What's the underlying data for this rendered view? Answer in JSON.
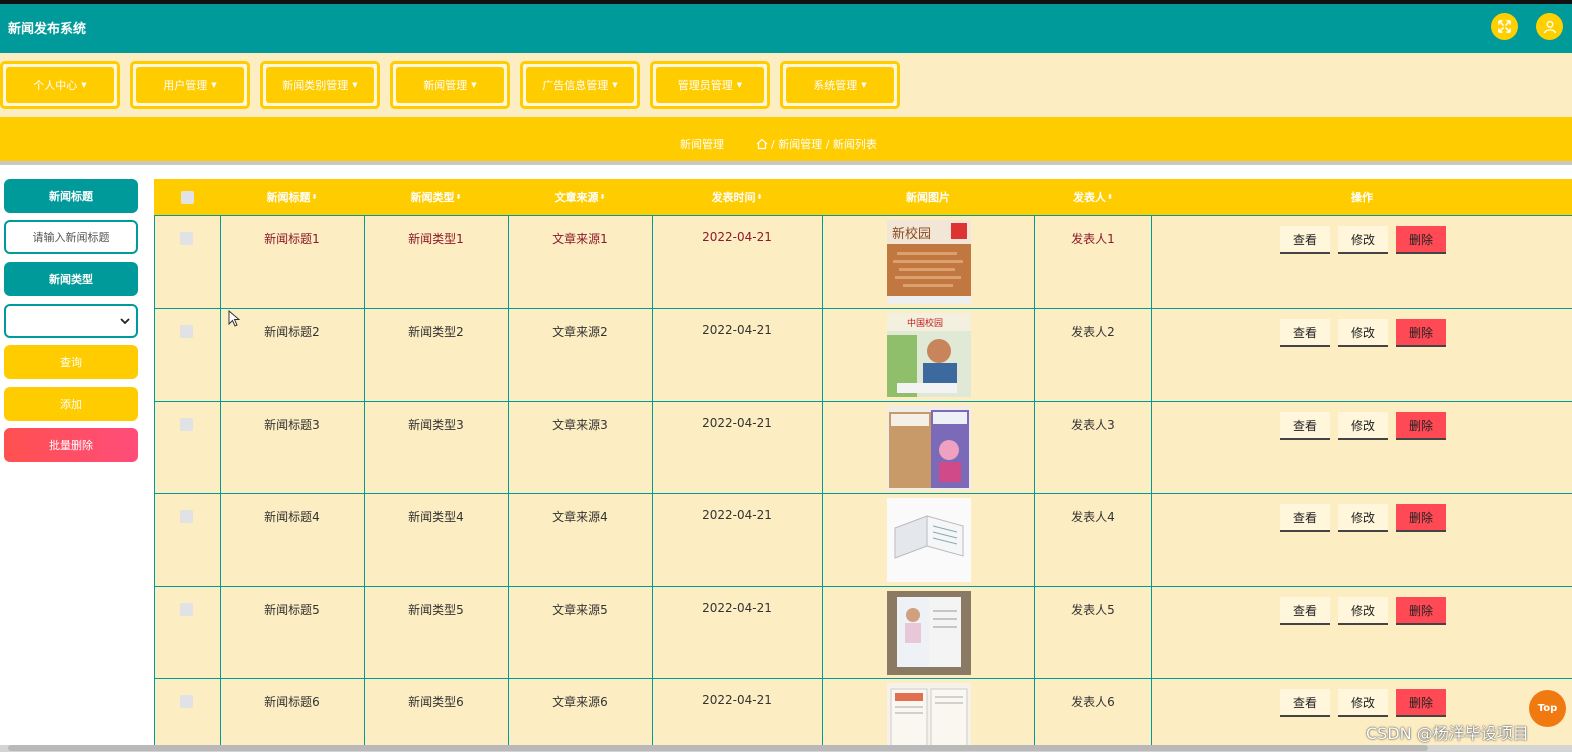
{
  "header": {
    "title": "新闻发布系统"
  },
  "nav": [
    {
      "label": "个人中心"
    },
    {
      "label": "用户管理"
    },
    {
      "label": "新闻类别管理"
    },
    {
      "label": "新闻管理"
    },
    {
      "label": "广告信息管理"
    },
    {
      "label": "管理员管理"
    },
    {
      "label": "系统管理"
    }
  ],
  "breadcrumb": {
    "title": "新闻管理",
    "path": "/ 新闻管理 / 新闻列表"
  },
  "sidebar": {
    "title_label": "新闻标题",
    "title_placeholder": "请输入新闻标题",
    "type_label": "新闻类型",
    "type_value": "",
    "query": "查询",
    "add": "添加",
    "batch_delete": "批量删除"
  },
  "table": {
    "headers": {
      "title": "新闻标题",
      "type": "新闻类型",
      "source": "文章来源",
      "time": "发表时间",
      "image": "新闻图片",
      "author": "发表人",
      "actions": "操作"
    },
    "rows": [
      {
        "title": "新闻标题1",
        "type": "新闻类型1",
        "source": "文章来源1",
        "time": "2022-04-21",
        "author": "发表人1"
      },
      {
        "title": "新闻标题2",
        "type": "新闻类型2",
        "source": "文章来源2",
        "time": "2022-04-21",
        "author": "发表人2"
      },
      {
        "title": "新闻标题3",
        "type": "新闻类型3",
        "source": "文章来源3",
        "time": "2022-04-21",
        "author": "发表人3"
      },
      {
        "title": "新闻标题4",
        "type": "新闻类型4",
        "source": "文章来源4",
        "time": "2022-04-21",
        "author": "发表人4"
      },
      {
        "title": "新闻标题5",
        "type": "新闻类型5",
        "source": "文章来源5",
        "time": "2022-04-21",
        "author": "发表人5"
      },
      {
        "title": "新闻标题6",
        "type": "新闻类型6",
        "source": "文章来源6",
        "time": "2022-04-21",
        "author": "发表人6"
      }
    ],
    "actions": {
      "view": "查看",
      "edit": "修改",
      "delete": "删除"
    }
  },
  "top_button": "Top",
  "watermark": "CSDN @杨洋毕设项目",
  "colors": {
    "primary": "#009a9a",
    "accent": "#ffcc00",
    "danger": "#ff4a55",
    "background": "#fdedc2"
  }
}
